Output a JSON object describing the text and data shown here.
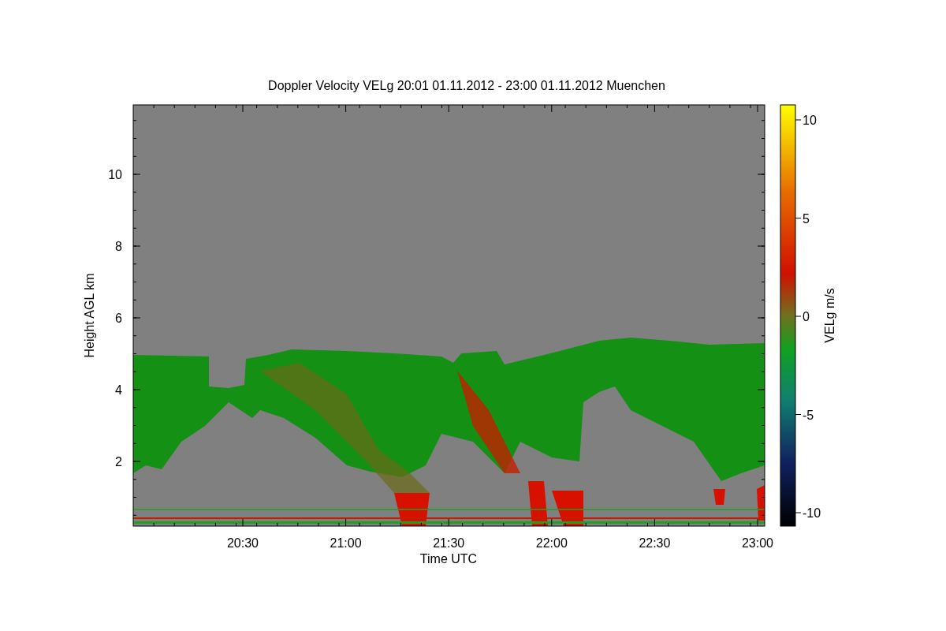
{
  "title": "Doppler Velocity VELg   20:01 01.11.2012 - 23:00 01.11.2012 Muenchen",
  "y_axis": {
    "label": "Height AGL km",
    "ticks": [
      "10",
      "8",
      "6",
      "4",
      "2"
    ]
  },
  "x_axis": {
    "label": "Time UTC",
    "ticks": [
      "20:30",
      "21:00",
      "21:30",
      "22:00",
      "22:30",
      "23:00"
    ]
  },
  "colorbar": {
    "label": "VELg m/s",
    "ticks": [
      "10",
      "5",
      "0",
      "-5",
      "-10"
    ]
  }
}
